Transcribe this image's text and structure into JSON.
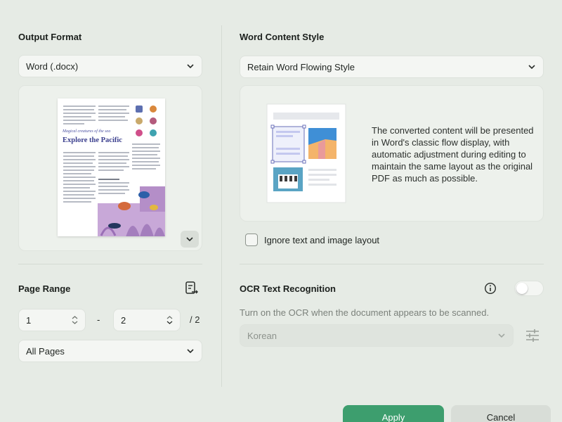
{
  "output_format": {
    "heading": "Output Format",
    "selected": "Word (.docx)"
  },
  "preview": {
    "thumb_heading_italic": "Magical creatures of the sea",
    "thumb_heading": "Explore the Pacific"
  },
  "page_range": {
    "heading": "Page Range",
    "from_value": "1",
    "to_value": "2",
    "separator": "-",
    "total_label": "/ 2",
    "scope_selected": "All Pages"
  },
  "word_content_style": {
    "heading": "Word Content Style",
    "selected": "Retain Word Flowing Style",
    "description": "The converted content will be presented in Word's classic flow display, with automatic adjustment during editing to maintain the same layout as the original PDF as much as possible."
  },
  "ignore_layout": {
    "label": "Ignore text and image layout",
    "checked": false
  },
  "ocr": {
    "heading": "OCR Text Recognition",
    "hint": "Turn on the OCR when the document appears to be scanned.",
    "language_selected": "Korean",
    "enabled": false
  },
  "buttons": {
    "apply_label": "Apply",
    "cancel_label": "Cancel"
  },
  "colors": {
    "accent": "#3d9e6e",
    "background": "#e6ebe5"
  }
}
